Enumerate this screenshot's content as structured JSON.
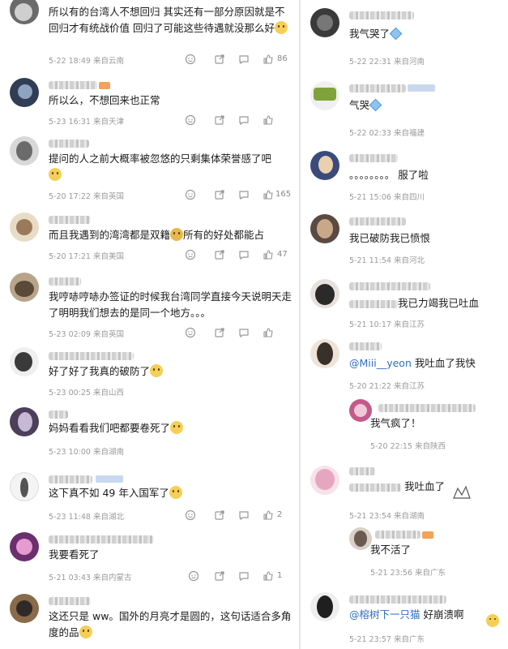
{
  "left": [
    {
      "text": "所以有的台湾人不想回归 其实还有一部分原因就是不回归才有统战价值 回归了可能这些待遇就没那么好",
      "time": "5-22 18:49",
      "loc": "来自云南",
      "likes": "86",
      "emoji": true
    },
    {
      "text": "所以么，不想回来也正常",
      "time": "5-23 16:31",
      "loc": "来自天津",
      "likes": "",
      "emoji": false
    },
    {
      "text": "提问的人之前大概率被忽悠的只剩集体荣誉感了吧",
      "time": "5-20 17:22",
      "loc": "来自英国",
      "likes": "165",
      "emoji": true
    },
    {
      "text": "而且我遇到的湾湾都是双籍",
      "text2": "所有的好处都能占",
      "time": "5-20 17:21",
      "loc": "来自美国",
      "likes": "47",
      "emoji": true
    },
    {
      "text": "我哼哧哼哧办签证的时候我台湾同学直接今天说明天走了明明我们想去的是同一个地方。。。",
      "time": "5-23 02:09",
      "loc": "来自英国",
      "likes": "",
      "emoji": false
    },
    {
      "text": "好了好了我真的破防了",
      "time": "5-23 00:25",
      "loc": "来自山西",
      "likes": "",
      "emoji": true
    },
    {
      "text": "妈妈看看我们吧都要卷死了",
      "time": "5-23 10:00",
      "loc": "来自湖南",
      "likes": "",
      "emoji": true
    },
    {
      "text": "这下真不如 49 年入国军了",
      "time": "5-23 11:48",
      "loc": "来自湖北",
      "likes": "2",
      "emoji": true
    },
    {
      "text": "我要看死了",
      "time": "5-21 03:43",
      "loc": "来自内蒙古",
      "likes": "1",
      "emoji": false
    },
    {
      "text": "这还只是 ww。国外的月亮才是圆的，这句话适合多角度的品",
      "time": "",
      "loc": "",
      "likes": "",
      "emoji": true
    }
  ],
  "right": [
    {
      "text": "我气哭了",
      "time": "5-22 22:31",
      "loc": "来自河南",
      "diamond": true
    },
    {
      "text": "气哭",
      "time": "5-22 02:33",
      "loc": "来自福建",
      "diamond": true
    },
    {
      "text": "。。。。。。。。 服了啦",
      "time": "5-21 15:06",
      "loc": "来自四川"
    },
    {
      "text": "我已破防我已愤恨",
      "time": "5-21 11:54",
      "loc": "来自河北"
    },
    {
      "text": "我已力竭我已吐血",
      "time": "5-21 10:17",
      "loc": "来自江苏"
    },
    {
      "mention": "@Miii__yeon",
      "text": " 我吐血了我快",
      "time": "5-20 21:22",
      "loc": "来自江苏"
    },
    {
      "text": "我气疯了！",
      "time": "5-20 22:15",
      "loc": "来自陕西",
      "reply": true
    },
    {
      "text": "我吐血了",
      "time": "5-21 23:54",
      "loc": "来自湖南"
    },
    {
      "text": "我不活了",
      "time": "5-21 23:56",
      "loc": "来自广东",
      "reply": true
    },
    {
      "mention": "@榕树下一只猫",
      "text": " 好崩溃啊",
      "time": "5-21 23:57",
      "loc": "来自广东"
    }
  ],
  "colors": {
    "meta": "#9a9a9a",
    "mention": "#2f6fbf",
    "divider": "#e6e6e6"
  },
  "icons": [
    "smile-icon",
    "share-icon",
    "comment-icon",
    "like-icon"
  ]
}
